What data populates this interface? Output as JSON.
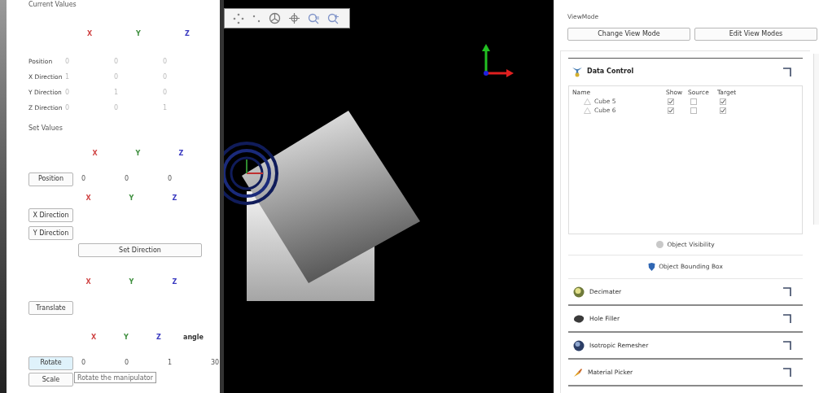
{
  "current_values": {
    "heading": "Current Values",
    "columns": [
      {
        "label": "X",
        "color": "#d04545"
      },
      {
        "label": "Y",
        "color": "#3f8f3f"
      },
      {
        "label": "Z",
        "color": "#3a3ac0"
      }
    ],
    "rows": [
      {
        "label": "Position",
        "values": [
          "0",
          "0",
          "0"
        ]
      },
      {
        "label": "X Direction",
        "values": [
          "1",
          "0",
          "0"
        ]
      },
      {
        "label": "Y Direction",
        "values": [
          "0",
          "1",
          "0"
        ]
      },
      {
        "label": "Z Direction",
        "values": [
          "0",
          "0",
          "1"
        ]
      }
    ]
  },
  "set_values": {
    "heading": "Set Values",
    "position": {
      "columns": [
        {
          "label": "X",
          "color": "#d04545"
        },
        {
          "label": "Y",
          "color": "#3f8f3f"
        },
        {
          "label": "Z",
          "color": "#3a3ac0"
        }
      ],
      "button": "Position",
      "values": [
        "0",
        "0",
        "0"
      ]
    },
    "direction": {
      "columns": [
        {
          "label": "X",
          "color": "#d04545"
        },
        {
          "label": "Y",
          "color": "#3f8f3f"
        },
        {
          "label": "Z",
          "color": "#3a3ac0"
        }
      ],
      "buttons": [
        "X Direction",
        "Y Direction"
      ],
      "set_button": "Set Direction"
    },
    "translate": {
      "columns": [
        {
          "label": "X",
          "color": "#d04545"
        },
        {
          "label": "Y",
          "color": "#3f8f3f"
        },
        {
          "label": "Z",
          "color": "#3a3ac0"
        }
      ],
      "button": "Translate"
    },
    "rotate": {
      "columns": [
        {
          "label": "X",
          "color": "#d04545"
        },
        {
          "label": "Y",
          "color": "#3f8f3f"
        },
        {
          "label": "Z",
          "color": "#3a3ac0"
        },
        {
          "label": "angle",
          "color": "#333333"
        }
      ],
      "button": "Rotate",
      "hovered": true,
      "values": [
        "0",
        "0",
        "1",
        "30"
      ]
    },
    "scale": {
      "button": "Scale"
    },
    "tooltip": "Rotate the manipulator"
  },
  "view_mode": {
    "label": "ViewMode",
    "buttons": [
      "Change View Mode",
      "Edit View Modes"
    ]
  },
  "data_control": {
    "title": "Data Control",
    "columns": [
      "Name",
      "Show",
      "Source",
      "Target"
    ],
    "rows": [
      {
        "name": "Cube 5",
        "show": true,
        "source": false,
        "target": true
      },
      {
        "name": "Cube 6",
        "show": true,
        "source": false,
        "target": true
      }
    ],
    "buttons": [
      {
        "label": "Object Visibility",
        "kind": "visibility"
      },
      {
        "label": "Object Bounding Box",
        "kind": "bounding"
      }
    ]
  },
  "plugins": [
    {
      "title": "Decimater",
      "kind": "decimater"
    },
    {
      "title": "Hole Filler",
      "kind": "holefiller"
    },
    {
      "title": "Isotropic Remesher",
      "kind": "remesher"
    },
    {
      "title": "Material Picker",
      "kind": "material"
    }
  ]
}
